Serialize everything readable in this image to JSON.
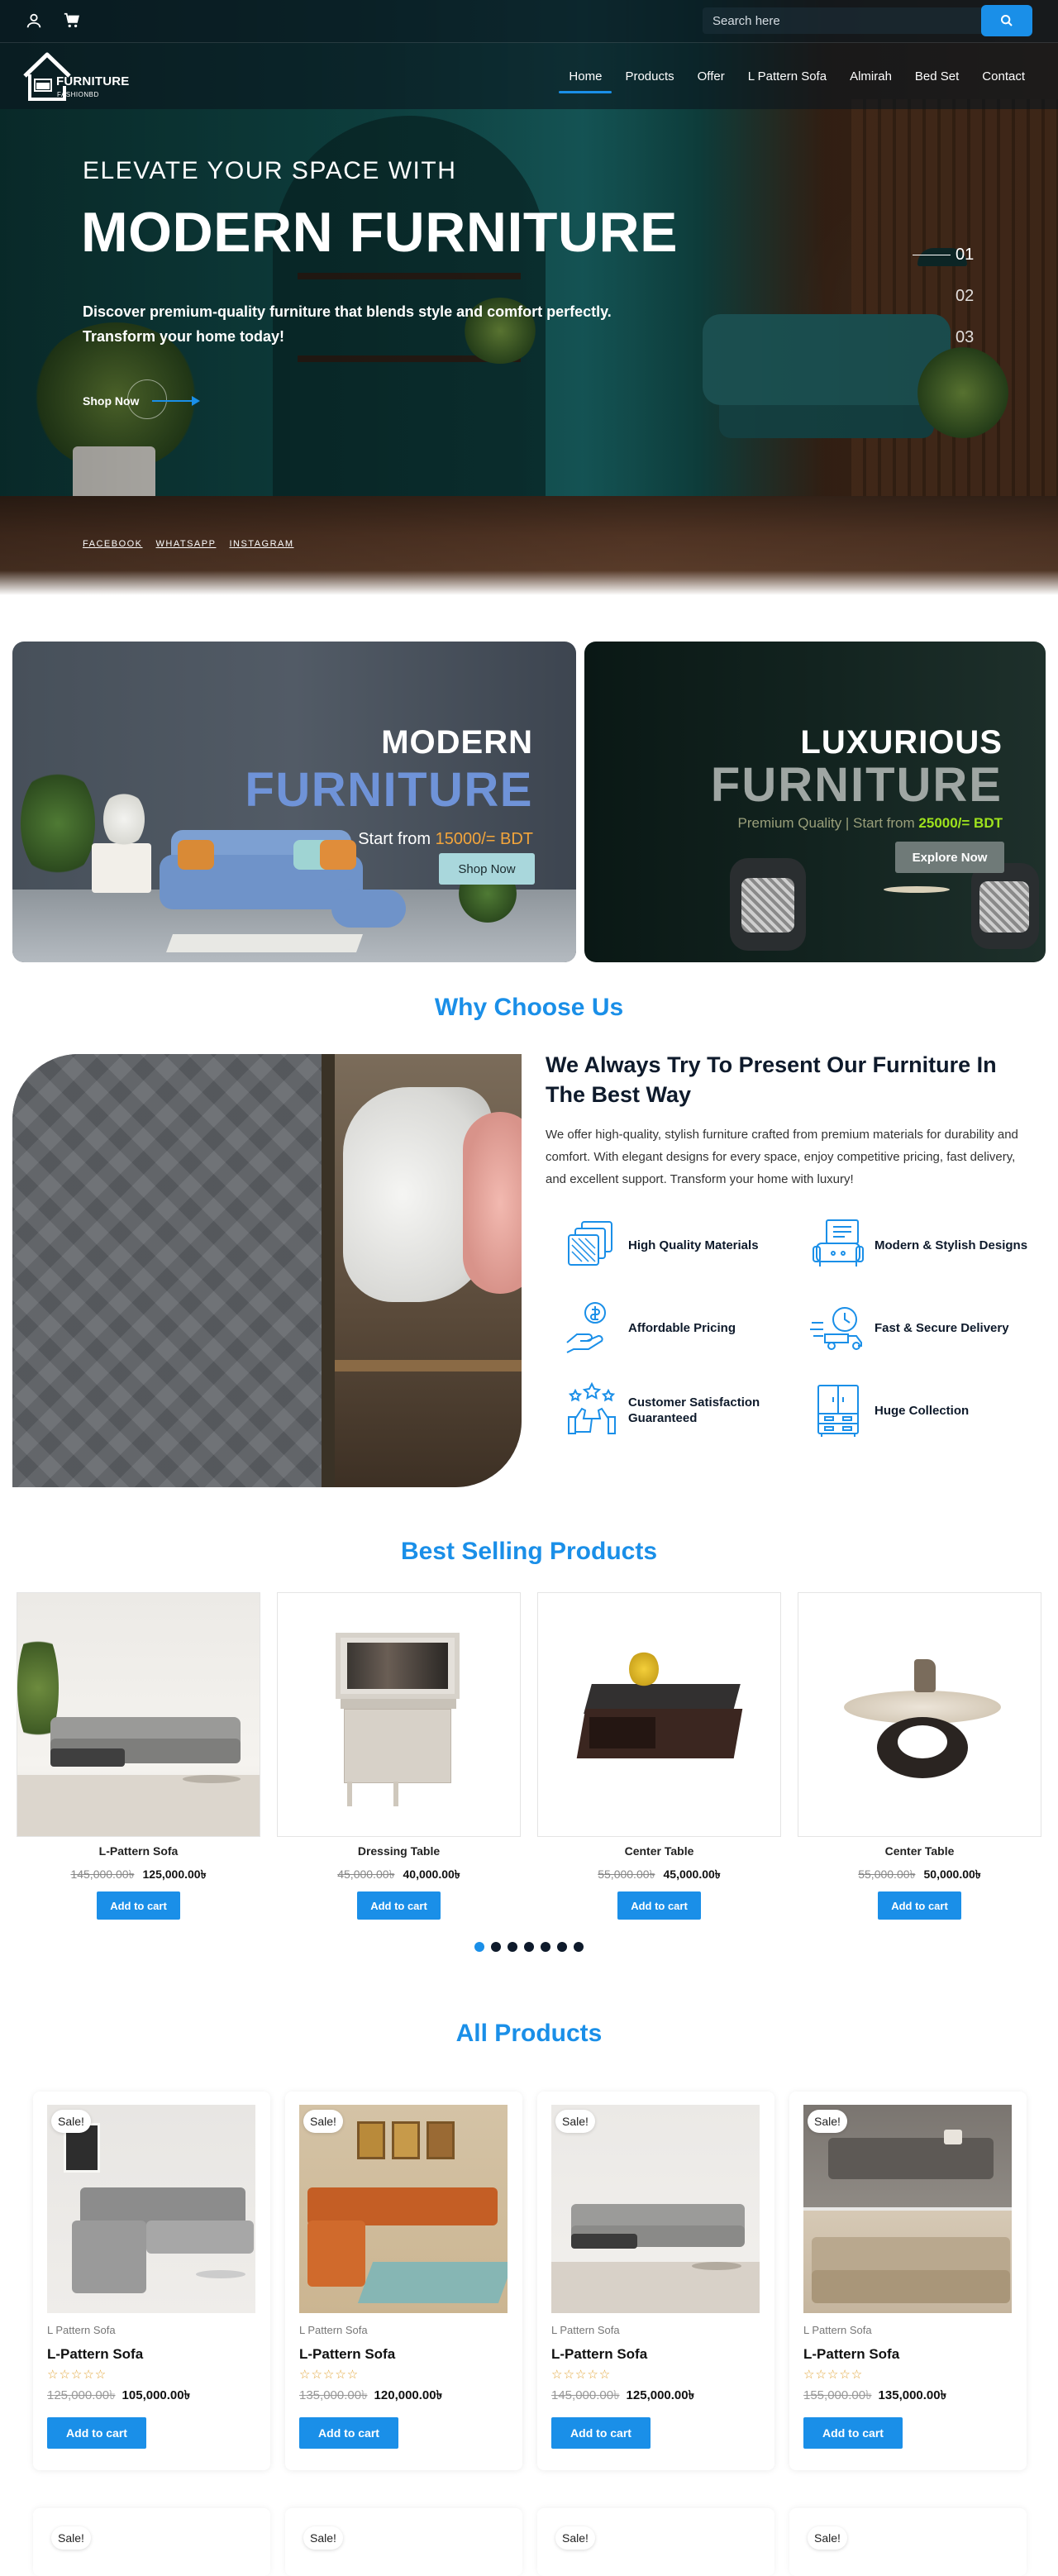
{
  "colors": {
    "accent": "#1a8fe8",
    "dark": "#0e1a2b",
    "sale_bg": "#ffffff",
    "star": "#e2a63b"
  },
  "topbar": {
    "icons": [
      "user-icon",
      "cart-icon"
    ],
    "search": {
      "placeholder": "Search here",
      "button_icon": "search-icon"
    }
  },
  "brand": {
    "name": "FURNITURE",
    "tagline": "FASHIONBD"
  },
  "nav": {
    "items": [
      "Home",
      "Products",
      "Offer",
      "L Pattern Sofa",
      "Almirah",
      "Bed Set",
      "Contact"
    ],
    "active": "Home"
  },
  "hero": {
    "kicker": "ELEVATE YOUR SPACE WITH",
    "title": "MODERN FURNITURE",
    "description": "Discover premium-quality furniture that blends style and comfort perfectly. Transform your home today!",
    "cta": "Shop Now",
    "socials": [
      "FACEBOOK",
      "WHATSAPP",
      "INSTAGRAM"
    ],
    "slides": [
      "01",
      "02",
      "03"
    ],
    "active_slide": "01"
  },
  "promo": {
    "modern": {
      "line1": "MODERN",
      "line2": "FURNITURE",
      "start_prefix": "Start from ",
      "start_price": "15000/= BDT",
      "button": "Shop Now"
    },
    "luxurious": {
      "line1": "LUXURIOUS",
      "line2": "FURNITURE",
      "sub_prefix": "Premium Quality | Start from ",
      "sub_price": "25000/= BDT",
      "button": "Explore Now"
    }
  },
  "why": {
    "title": "Why Choose Us",
    "heading": "We Always Try To Present Our Furniture In The Best Way",
    "text": "We offer high-quality, stylish furniture crafted from premium materials for durability and comfort. With elegant designs for every space, enjoy competitive pricing, fast delivery, and excellent support. Transform your home with luxury!",
    "features": [
      {
        "label": "High Quality Materials",
        "icon": "material-swatch-icon"
      },
      {
        "label": "Modern & Stylish Designs",
        "icon": "sofa-design-icon"
      },
      {
        "label": "Affordable Pricing",
        "icon": "money-hand-icon"
      },
      {
        "label": "Fast & Secure Delivery",
        "icon": "delivery-truck-icon"
      },
      {
        "label": "Customer Satisfaction Guaranteed",
        "icon": "thumbs-up-stars-icon"
      },
      {
        "label": "Huge Collection",
        "icon": "cabinet-icon"
      }
    ]
  },
  "best_selling": {
    "title": "Best Selling Products",
    "products": [
      {
        "name": "L-Pattern Sofa",
        "old_price": "145,000.00৳",
        "price": "125,000.00৳",
        "button": "Add to cart"
      },
      {
        "name": "Dressing Table",
        "old_price": "45,000.00৳",
        "price": "40,000.00৳",
        "button": "Add to cart"
      },
      {
        "name": "Center Table",
        "old_price": "55,000.00৳",
        "price": "45,000.00৳",
        "button": "Add to cart"
      },
      {
        "name": "Center Table",
        "old_price": "55,000.00৳",
        "price": "50,000.00৳",
        "button": "Add to cart"
      }
    ],
    "carousel_dots": 7,
    "active_dot": 1
  },
  "all_products": {
    "title": "All Products",
    "products": [
      {
        "badge": "Sale!",
        "category": "L Pattern Sofa",
        "name": "L-Pattern Sofa",
        "rating": 0,
        "rating_max": 5,
        "old_price": "125,000.00৳",
        "price": "105,000.00৳",
        "button": "Add to cart"
      },
      {
        "badge": "Sale!",
        "category": "L Pattern Sofa",
        "name": "L-Pattern Sofa",
        "rating": 0,
        "rating_max": 5,
        "old_price": "135,000.00৳",
        "price": "120,000.00৳",
        "button": "Add to cart"
      },
      {
        "badge": "Sale!",
        "category": "L Pattern Sofa",
        "name": "L-Pattern Sofa",
        "rating": 0,
        "rating_max": 5,
        "old_price": "145,000.00৳",
        "price": "125,000.00৳",
        "button": "Add to cart"
      },
      {
        "badge": "Sale!",
        "category": "L Pattern Sofa",
        "name": "L-Pattern Sofa",
        "rating": 0,
        "rating_max": 5,
        "old_price": "155,000.00৳",
        "price": "135,000.00৳",
        "button": "Add to cart"
      }
    ],
    "next_row_badges": [
      "Sale!",
      "Sale!",
      "Sale!",
      "Sale!"
    ]
  }
}
